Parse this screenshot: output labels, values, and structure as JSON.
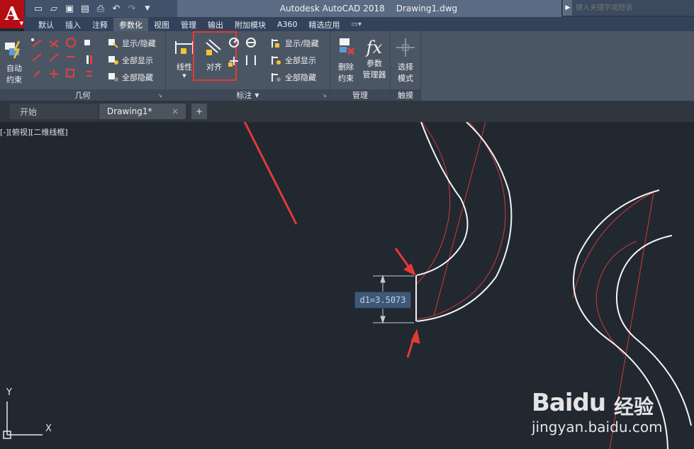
{
  "app": {
    "logo_letter": "A",
    "title_app": "Autodesk AutoCAD 2018",
    "title_file": "Drawing1.dwg",
    "search_placeholder": "键入关键字或短语"
  },
  "ribbon_tabs": [
    "默认",
    "插入",
    "注释",
    "参数化",
    "视图",
    "管理",
    "输出",
    "附加模块",
    "A360",
    "精选应用"
  ],
  "active_tab": "参数化",
  "panels": {
    "geometry": {
      "title": "几何",
      "auto_constrain_label_1": "自动",
      "auto_constrain_label_2": "约束",
      "show_hide": "显示/隐藏",
      "show_all": "全部显示",
      "hide_all": "全部隐藏"
    },
    "dimensional": {
      "title": "标注",
      "linear": "线性",
      "aligned": "对齐",
      "show_hide": "显示/隐藏",
      "show_all": "全部显示",
      "hide_all": "全部隐藏"
    },
    "manage": {
      "title": "管理",
      "delete_1": "删除",
      "delete_2": "约束",
      "params_1": "参数",
      "params_2": "管理器"
    },
    "select": {
      "title": "触摸",
      "mode_1": "选择",
      "mode_2": "模式"
    }
  },
  "doc_tabs": {
    "start": "开始",
    "drawing": "Drawing1*",
    "close": "×",
    "add": "+"
  },
  "viewport": {
    "label": "[-][俯视][二维线框]",
    "dimension_text": "d1=3.5073",
    "ucs_x": "X",
    "ucs_y": "Y"
  },
  "watermark": {
    "logo": "Baidu",
    "cn": "经验",
    "url": "jingyan.baidu.com"
  },
  "colors": {
    "accent_red": "#e53935",
    "ribbon_bg": "#4b5665",
    "canvas_bg": "#212830"
  }
}
